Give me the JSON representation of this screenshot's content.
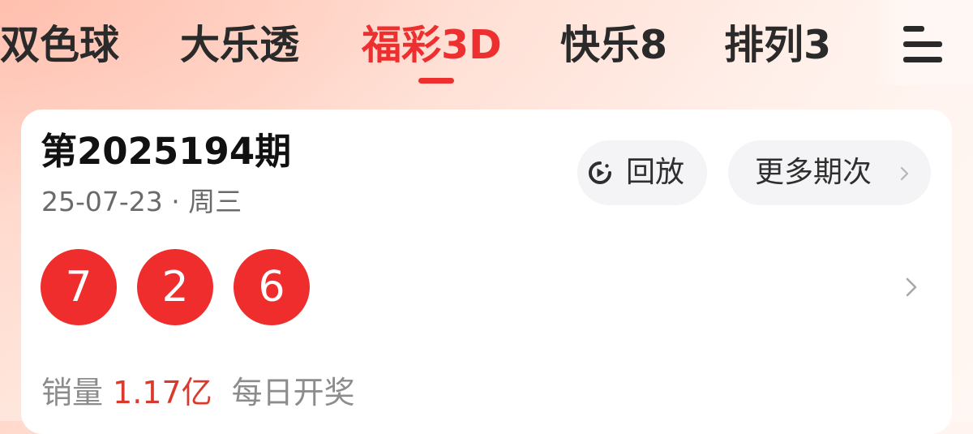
{
  "tabs": [
    {
      "label": "双色球",
      "active": false
    },
    {
      "label": "大乐透",
      "active": false
    },
    {
      "label": "福彩3D",
      "active": true
    },
    {
      "label": "快乐8",
      "active": false
    },
    {
      "label": "排列3",
      "active": false
    }
  ],
  "menu": {
    "icon": "hamburger-menu-icon"
  },
  "card": {
    "issue_title": "第2025194期",
    "date": "25-07-23 · 周三",
    "replay_label": "回放",
    "more_issues_label": "更多期次",
    "numbers": [
      "7",
      "2",
      "6"
    ],
    "sales_label": "销量",
    "sales_value": "1.17亿",
    "draw_schedule": "每日开奖"
  },
  "colors": {
    "accent": "#ee2f2f",
    "ball": "#ef2d2d",
    "sales_value": "#d93a2e",
    "text_primary": "#111111",
    "text_secondary": "#6a6a6a",
    "pill_bg": "#f4f4f6"
  }
}
